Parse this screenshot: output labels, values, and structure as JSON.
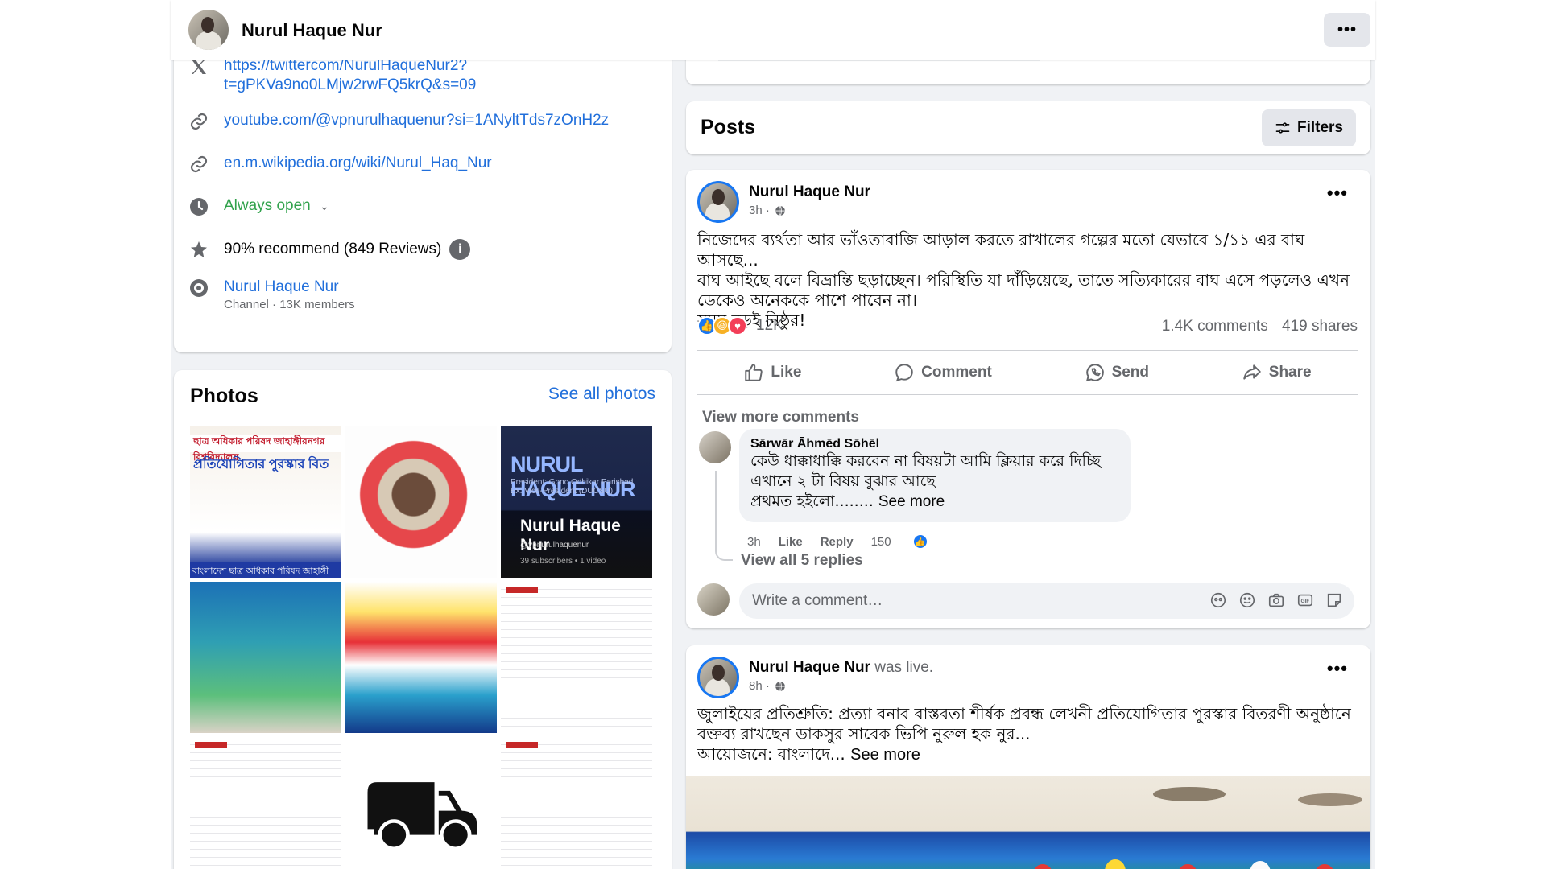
{
  "page": {
    "name": "Nurul Haque Nur",
    "menu_icon": "more-horizontal-icon"
  },
  "intro": {
    "twitter": "https://twittercom/NurulHaqueNur2?t=gPKVa9no0LMjw2rwFQ5krQ&s=09",
    "twitter_line1": "https://twittercom/NurulHaqueNur2?",
    "twitter_line2": "t=gPKVa9no0LMjw2rwFQ5krQ&s=09",
    "youtube": "youtube.com/@vpnurulhaquenur?si=1ANyltTds7zOnH2z",
    "wikipedia": "en.m.wikipedia.org/wiki/Nurul_Haq_Nur",
    "hours": "Always open",
    "recommend": "90% recommend (849 Reviews)",
    "channel_name": "Nurul Haque Nur",
    "channel_meta": "Channel · 13K members"
  },
  "photos": {
    "title": "Photos",
    "see_all": "See all photos",
    "thumbs": {
      "p1_header": "ছাত্র অধিকার পরিষদ জাহাঙ্গীরনগর বিশ্ববিদ্যালয়",
      "p1_title": "প্রতিযোগিতার পুরস্কার বিত",
      "p1_strip": "বাংলাদেশ ছাত্র অধিকার পরিষদ জাহাঙ্গী",
      "p3_title": "NURUL HAQUE NUR",
      "p3_sub1": "President: Gono Odhikar Parishad",
      "p3_sub2": "Ex: Vice-President (DUCSU)",
      "p3_name": "Nurul Haque Nur",
      "p3_handle": "@vpnurulhaquenur",
      "p3_stats": "39 subscribers • 1 video"
    }
  },
  "posts_bar": {
    "title": "Posts",
    "filters": "Filters"
  },
  "post1": {
    "author": "Nurul Haque Nur",
    "time": "3h ·",
    "text1": "নিজেদের ব্যর্থতা আর ভাঁওতাবাজি আড়াল করতে রাখালের গল্পের মতো যেভাবে ১/১১ এর বাঘ আসছে...",
    "text2": "বাঘ আইছে বলে বিভ্রান্তি ছড়াচ্ছেন। পরিস্থিতি যা দাঁড়িয়েছে, তাতে সত্যিকারের বাঘ এসে পড়লেও এখন",
    "text3": "ডেকেও অনেককে পাশে পাবেন না।",
    "text4": "সময় বড়ই নিষ্ঠুর!",
    "reactions": "12K",
    "comments": "1.4K comments",
    "shares": "419 shares",
    "actions": {
      "like": "Like",
      "comment": "Comment",
      "send": "Send",
      "share": "Share"
    },
    "view_more": "View more comments",
    "comment": {
      "author": "Sārwār Āhmēd Sōhēl",
      "line1": "কেউ ধাক্কাধাক্কি করবেন না বিষয়টা আমি ক্লিয়ার করে দিচ্ছি",
      "line2": "এখানে ২ টা বিষয় বুঝার আছে",
      "line3": "প্রথমত হইলো........",
      "see_more": "See more",
      "time": "3h",
      "like": "Like",
      "reply": "Reply",
      "likes": "150"
    },
    "view_all_replies": "View all 5 replies",
    "write_placeholder": "Write a comment…"
  },
  "post2": {
    "author": "Nurul Haque Nur",
    "was_live": "was live.",
    "time": "8h ·",
    "text1": "জুলাইয়ের প্রতিশ্রুতি: প্রত্যা বনাব বাস্তবতা শীর্ষক প্রবন্ধ লেখনী প্রতিযোগিতার পুরস্কার বিতরণী অনুষ্ঠানে",
    "text2": "বক্তব্য রাখছেন ডাকসুর সাবেক ভিপি নুরুল হক নুর...",
    "text3": "আয়োজনে: বাংলাদে...",
    "see_more": "See more"
  },
  "colors": {
    "link": "#216fdb",
    "green": "#31a24c",
    "like_blue": "#1877f2",
    "muted": "#65676b"
  }
}
